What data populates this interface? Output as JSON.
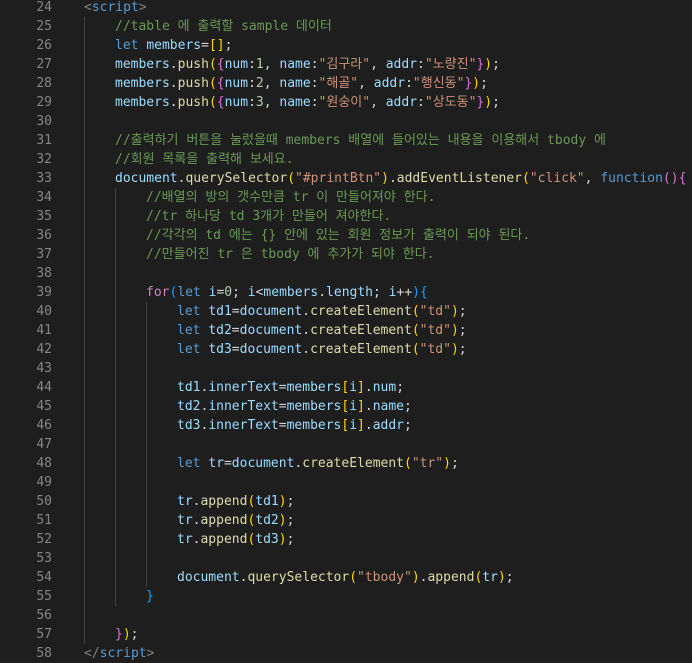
{
  "editor": {
    "first_line": 24,
    "lines": [
      {
        "indent": 0,
        "tokens": [
          {
            "t": "<",
            "k": "bracket"
          },
          {
            "t": "script",
            "k": "tag"
          },
          {
            "t": ">",
            "k": "bracket"
          }
        ]
      },
      {
        "indent": 1,
        "tokens": [
          {
            "t": "//table 에 출력할 sample 데이터",
            "k": "comment"
          }
        ]
      },
      {
        "indent": 1,
        "tokens": [
          {
            "t": "let ",
            "k": "keyword"
          },
          {
            "t": "members",
            "k": "var"
          },
          {
            "t": "=",
            "k": "punct"
          },
          {
            "t": "[]",
            "k": "b1"
          },
          {
            "t": ";",
            "k": "punct"
          }
        ]
      },
      {
        "indent": 1,
        "tokens": [
          {
            "t": "members",
            "k": "var"
          },
          {
            "t": ".",
            "k": "punct"
          },
          {
            "t": "push",
            "k": "func"
          },
          {
            "t": "(",
            "k": "b1"
          },
          {
            "t": "{",
            "k": "b2"
          },
          {
            "t": "num",
            "k": "var"
          },
          {
            "t": ":",
            "k": "punct"
          },
          {
            "t": "1",
            "k": "number"
          },
          {
            "t": ", ",
            "k": "punct"
          },
          {
            "t": "name",
            "k": "var"
          },
          {
            "t": ":",
            "k": "punct"
          },
          {
            "t": "\"김구라\"",
            "k": "string"
          },
          {
            "t": ", ",
            "k": "punct"
          },
          {
            "t": "addr",
            "k": "var"
          },
          {
            "t": ":",
            "k": "punct"
          },
          {
            "t": "\"노량진\"",
            "k": "string"
          },
          {
            "t": "}",
            "k": "b2"
          },
          {
            "t": ")",
            "k": "b1"
          },
          {
            "t": ";",
            "k": "punct"
          }
        ]
      },
      {
        "indent": 1,
        "tokens": [
          {
            "t": "members",
            "k": "var"
          },
          {
            "t": ".",
            "k": "punct"
          },
          {
            "t": "push",
            "k": "func"
          },
          {
            "t": "(",
            "k": "b1"
          },
          {
            "t": "{",
            "k": "b2"
          },
          {
            "t": "num",
            "k": "var"
          },
          {
            "t": ":",
            "k": "punct"
          },
          {
            "t": "2",
            "k": "number"
          },
          {
            "t": ", ",
            "k": "punct"
          },
          {
            "t": "name",
            "k": "var"
          },
          {
            "t": ":",
            "k": "punct"
          },
          {
            "t": "\"해골\"",
            "k": "string"
          },
          {
            "t": ", ",
            "k": "punct"
          },
          {
            "t": "addr",
            "k": "var"
          },
          {
            "t": ":",
            "k": "punct"
          },
          {
            "t": "\"행신동\"",
            "k": "string"
          },
          {
            "t": "}",
            "k": "b2"
          },
          {
            "t": ")",
            "k": "b1"
          },
          {
            "t": ";",
            "k": "punct"
          }
        ]
      },
      {
        "indent": 1,
        "tokens": [
          {
            "t": "members",
            "k": "var"
          },
          {
            "t": ".",
            "k": "punct"
          },
          {
            "t": "push",
            "k": "func"
          },
          {
            "t": "(",
            "k": "b1"
          },
          {
            "t": "{",
            "k": "b2"
          },
          {
            "t": "num",
            "k": "var"
          },
          {
            "t": ":",
            "k": "punct"
          },
          {
            "t": "3",
            "k": "number"
          },
          {
            "t": ", ",
            "k": "punct"
          },
          {
            "t": "name",
            "k": "var"
          },
          {
            "t": ":",
            "k": "punct"
          },
          {
            "t": "\"원숭이\"",
            "k": "string"
          },
          {
            "t": ", ",
            "k": "punct"
          },
          {
            "t": "addr",
            "k": "var"
          },
          {
            "t": ":",
            "k": "punct"
          },
          {
            "t": "\"상도동\"",
            "k": "string"
          },
          {
            "t": "}",
            "k": "b2"
          },
          {
            "t": ")",
            "k": "b1"
          },
          {
            "t": ";",
            "k": "punct"
          }
        ]
      },
      {
        "indent": 1,
        "tokens": []
      },
      {
        "indent": 1,
        "tokens": [
          {
            "t": "//출력하기 버튼을 눌렀을때 members 배열에 들어있는 내용을 이용해서 tbody 에",
            "k": "comment"
          }
        ]
      },
      {
        "indent": 1,
        "tokens": [
          {
            "t": "//회원 목록을 출력해 보세요.",
            "k": "comment"
          }
        ]
      },
      {
        "indent": 1,
        "tokens": [
          {
            "t": "document",
            "k": "var"
          },
          {
            "t": ".",
            "k": "punct"
          },
          {
            "t": "querySelector",
            "k": "func"
          },
          {
            "t": "(",
            "k": "b1"
          },
          {
            "t": "\"#printBtn\"",
            "k": "string"
          },
          {
            "t": ")",
            "k": "b1"
          },
          {
            "t": ".",
            "k": "punct"
          },
          {
            "t": "addEventListener",
            "k": "func"
          },
          {
            "t": "(",
            "k": "b1"
          },
          {
            "t": "\"click\"",
            "k": "string"
          },
          {
            "t": ", ",
            "k": "punct"
          },
          {
            "t": "function",
            "k": "keyword"
          },
          {
            "t": "()",
            "k": "b2"
          },
          {
            "t": "{",
            "k": "b2"
          }
        ]
      },
      {
        "indent": 2,
        "tokens": [
          {
            "t": "//배열의 방의 갯수만큼 tr 이 만들어져야 한다.",
            "k": "comment"
          }
        ]
      },
      {
        "indent": 2,
        "tokens": [
          {
            "t": "//tr 하나당 td 3개가 만들어 져야한다.",
            "k": "comment"
          }
        ]
      },
      {
        "indent": 2,
        "tokens": [
          {
            "t": "//각각의 td 에는 {} 안에 있는 회원 정보가 출력이 되야 된다.",
            "k": "comment"
          }
        ]
      },
      {
        "indent": 2,
        "tokens": [
          {
            "t": "//만들어진 tr 은 tbody 에 추가가 되야 한다.",
            "k": "comment"
          }
        ]
      },
      {
        "indent": 2,
        "tokens": []
      },
      {
        "indent": 2,
        "tokens": [
          {
            "t": "for",
            "k": "control"
          },
          {
            "t": "(",
            "k": "b3"
          },
          {
            "t": "let ",
            "k": "keyword"
          },
          {
            "t": "i",
            "k": "var"
          },
          {
            "t": "=",
            "k": "punct"
          },
          {
            "t": "0",
            "k": "number"
          },
          {
            "t": "; ",
            "k": "punct"
          },
          {
            "t": "i",
            "k": "var"
          },
          {
            "t": "<",
            "k": "punct"
          },
          {
            "t": "members",
            "k": "var"
          },
          {
            "t": ".",
            "k": "punct"
          },
          {
            "t": "length",
            "k": "var"
          },
          {
            "t": "; ",
            "k": "punct"
          },
          {
            "t": "i",
            "k": "var"
          },
          {
            "t": "++",
            "k": "punct"
          },
          {
            "t": ")",
            "k": "b3"
          },
          {
            "t": "{",
            "k": "b3"
          }
        ]
      },
      {
        "indent": 3,
        "tokens": [
          {
            "t": "let ",
            "k": "keyword"
          },
          {
            "t": "td1",
            "k": "var"
          },
          {
            "t": "=",
            "k": "punct"
          },
          {
            "t": "document",
            "k": "var"
          },
          {
            "t": ".",
            "k": "punct"
          },
          {
            "t": "createElement",
            "k": "func"
          },
          {
            "t": "(",
            "k": "b1"
          },
          {
            "t": "\"td\"",
            "k": "string"
          },
          {
            "t": ")",
            "k": "b1"
          },
          {
            "t": ";",
            "k": "punct"
          }
        ]
      },
      {
        "indent": 3,
        "tokens": [
          {
            "t": "let ",
            "k": "keyword"
          },
          {
            "t": "td2",
            "k": "var"
          },
          {
            "t": "=",
            "k": "punct"
          },
          {
            "t": "document",
            "k": "var"
          },
          {
            "t": ".",
            "k": "punct"
          },
          {
            "t": "createElement",
            "k": "func"
          },
          {
            "t": "(",
            "k": "b1"
          },
          {
            "t": "\"td\"",
            "k": "string"
          },
          {
            "t": ")",
            "k": "b1"
          },
          {
            "t": ";",
            "k": "punct"
          }
        ]
      },
      {
        "indent": 3,
        "tokens": [
          {
            "t": "let ",
            "k": "keyword"
          },
          {
            "t": "td3",
            "k": "var"
          },
          {
            "t": "=",
            "k": "punct"
          },
          {
            "t": "document",
            "k": "var"
          },
          {
            "t": ".",
            "k": "punct"
          },
          {
            "t": "createElement",
            "k": "func"
          },
          {
            "t": "(",
            "k": "b1"
          },
          {
            "t": "\"td\"",
            "k": "string"
          },
          {
            "t": ")",
            "k": "b1"
          },
          {
            "t": ";",
            "k": "punct"
          }
        ]
      },
      {
        "indent": 3,
        "tokens": []
      },
      {
        "indent": 3,
        "tokens": [
          {
            "t": "td1",
            "k": "var"
          },
          {
            "t": ".",
            "k": "punct"
          },
          {
            "t": "innerText",
            "k": "var"
          },
          {
            "t": "=",
            "k": "punct"
          },
          {
            "t": "members",
            "k": "var"
          },
          {
            "t": "[",
            "k": "b1"
          },
          {
            "t": "i",
            "k": "var"
          },
          {
            "t": "]",
            "k": "b1"
          },
          {
            "t": ".",
            "k": "punct"
          },
          {
            "t": "num",
            "k": "var"
          },
          {
            "t": ";",
            "k": "punct"
          }
        ]
      },
      {
        "indent": 3,
        "tokens": [
          {
            "t": "td2",
            "k": "var"
          },
          {
            "t": ".",
            "k": "punct"
          },
          {
            "t": "innerText",
            "k": "var"
          },
          {
            "t": "=",
            "k": "punct"
          },
          {
            "t": "members",
            "k": "var"
          },
          {
            "t": "[",
            "k": "b1"
          },
          {
            "t": "i",
            "k": "var"
          },
          {
            "t": "]",
            "k": "b1"
          },
          {
            "t": ".",
            "k": "punct"
          },
          {
            "t": "name",
            "k": "var"
          },
          {
            "t": ";",
            "k": "punct"
          }
        ]
      },
      {
        "indent": 3,
        "tokens": [
          {
            "t": "td3",
            "k": "var"
          },
          {
            "t": ".",
            "k": "punct"
          },
          {
            "t": "innerText",
            "k": "var"
          },
          {
            "t": "=",
            "k": "punct"
          },
          {
            "t": "members",
            "k": "var"
          },
          {
            "t": "[",
            "k": "b1"
          },
          {
            "t": "i",
            "k": "var"
          },
          {
            "t": "]",
            "k": "b1"
          },
          {
            "t": ".",
            "k": "punct"
          },
          {
            "t": "addr",
            "k": "var"
          },
          {
            "t": ";",
            "k": "punct"
          }
        ]
      },
      {
        "indent": 3,
        "tokens": []
      },
      {
        "indent": 3,
        "tokens": [
          {
            "t": "let ",
            "k": "keyword"
          },
          {
            "t": "tr",
            "k": "var"
          },
          {
            "t": "=",
            "k": "punct"
          },
          {
            "t": "document",
            "k": "var"
          },
          {
            "t": ".",
            "k": "punct"
          },
          {
            "t": "createElement",
            "k": "func"
          },
          {
            "t": "(",
            "k": "b1"
          },
          {
            "t": "\"tr\"",
            "k": "string"
          },
          {
            "t": ")",
            "k": "b1"
          },
          {
            "t": ";",
            "k": "punct"
          }
        ]
      },
      {
        "indent": 3,
        "tokens": []
      },
      {
        "indent": 3,
        "tokens": [
          {
            "t": "tr",
            "k": "var"
          },
          {
            "t": ".",
            "k": "punct"
          },
          {
            "t": "append",
            "k": "func"
          },
          {
            "t": "(",
            "k": "b1"
          },
          {
            "t": "td1",
            "k": "var"
          },
          {
            "t": ")",
            "k": "b1"
          },
          {
            "t": ";",
            "k": "punct"
          }
        ]
      },
      {
        "indent": 3,
        "tokens": [
          {
            "t": "tr",
            "k": "var"
          },
          {
            "t": ".",
            "k": "punct"
          },
          {
            "t": "append",
            "k": "func"
          },
          {
            "t": "(",
            "k": "b1"
          },
          {
            "t": "td2",
            "k": "var"
          },
          {
            "t": ")",
            "k": "b1"
          },
          {
            "t": ";",
            "k": "punct"
          }
        ]
      },
      {
        "indent": 3,
        "tokens": [
          {
            "t": "tr",
            "k": "var"
          },
          {
            "t": ".",
            "k": "punct"
          },
          {
            "t": "append",
            "k": "func"
          },
          {
            "t": "(",
            "k": "b1"
          },
          {
            "t": "td3",
            "k": "var"
          },
          {
            "t": ")",
            "k": "b1"
          },
          {
            "t": ";",
            "k": "punct"
          }
        ]
      },
      {
        "indent": 3,
        "tokens": []
      },
      {
        "indent": 3,
        "tokens": [
          {
            "t": "document",
            "k": "var"
          },
          {
            "t": ".",
            "k": "punct"
          },
          {
            "t": "querySelector",
            "k": "func"
          },
          {
            "t": "(",
            "k": "b1"
          },
          {
            "t": "\"tbody\"",
            "k": "string"
          },
          {
            "t": ")",
            "k": "b1"
          },
          {
            "t": ".",
            "k": "punct"
          },
          {
            "t": "append",
            "k": "func"
          },
          {
            "t": "(",
            "k": "b1"
          },
          {
            "t": "tr",
            "k": "var"
          },
          {
            "t": ")",
            "k": "b1"
          },
          {
            "t": ";",
            "k": "punct"
          }
        ]
      },
      {
        "indent": 2,
        "tokens": [
          {
            "t": "}",
            "k": "b3"
          }
        ]
      },
      {
        "indent": 1,
        "tokens": []
      },
      {
        "indent": 1,
        "tokens": [
          {
            "t": "}",
            "k": "b2"
          },
          {
            "t": ")",
            "k": "b1"
          },
          {
            "t": ";",
            "k": "punct"
          }
        ]
      },
      {
        "indent": 0,
        "tokens": [
          {
            "t": "</",
            "k": "bracket"
          },
          {
            "t": "script",
            "k": "tag"
          },
          {
            "t": ">",
            "k": "bracket"
          }
        ]
      }
    ]
  }
}
